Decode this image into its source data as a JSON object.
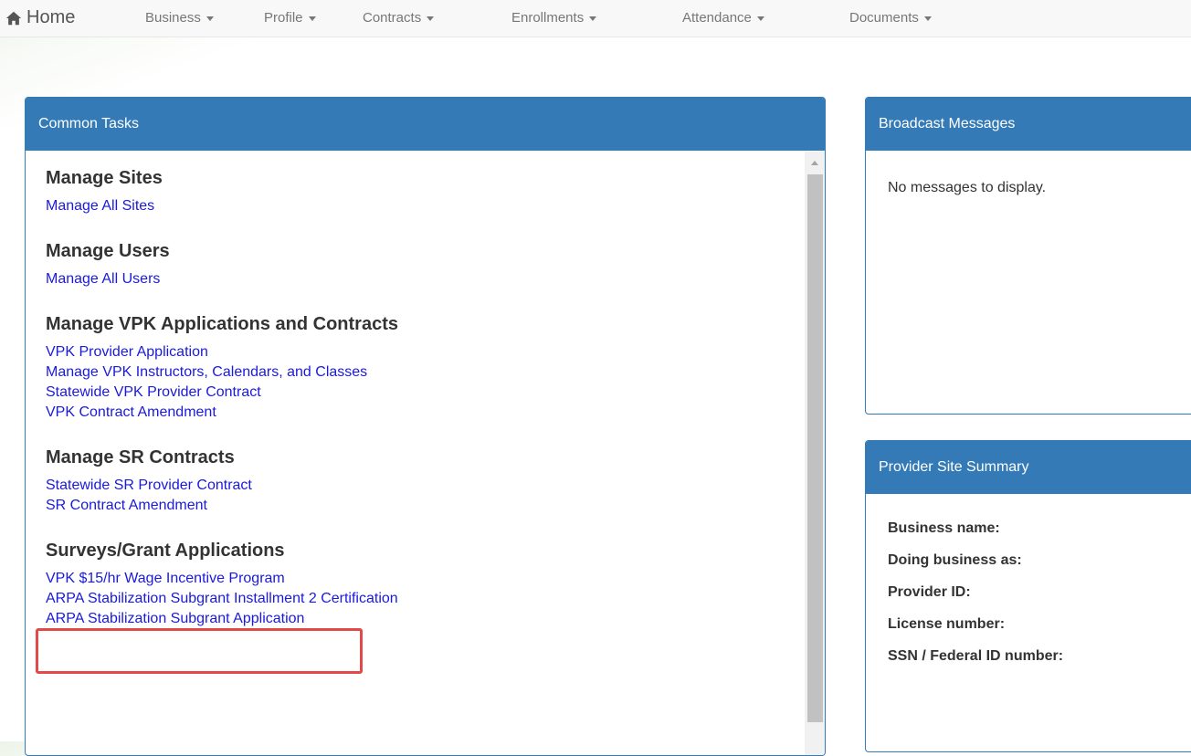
{
  "navbar": {
    "home_label": "Home",
    "items": [
      {
        "label": "Business"
      },
      {
        "label": "Profile"
      },
      {
        "label": "Contracts"
      },
      {
        "label": "Enrollments"
      },
      {
        "label": "Attendance"
      },
      {
        "label": "Documents"
      }
    ]
  },
  "common_tasks": {
    "title": "Common Tasks",
    "sections": [
      {
        "heading": "Manage Sites",
        "links": [
          "Manage All Sites"
        ]
      },
      {
        "heading": "Manage Users",
        "links": [
          "Manage All Users"
        ]
      },
      {
        "heading": "Manage VPK Applications and Contracts",
        "links": [
          "VPK Provider Application",
          "Manage VPK Instructors, Calendars, and Classes",
          "Statewide VPK Provider Contract",
          "VPK Contract Amendment"
        ]
      },
      {
        "heading": "Manage SR Contracts",
        "links": [
          "Statewide SR Provider Contract",
          "SR Contract Amendment"
        ]
      },
      {
        "heading": "Surveys/Grant Applications",
        "links": [
          "VPK $15/hr Wage Incentive Program",
          "ARPA Stabilization Subgrant Installment 2 Certification",
          "ARPA Stabilization Subgrant Application"
        ]
      }
    ]
  },
  "broadcast": {
    "title": "Broadcast Messages",
    "message": "No messages to display."
  },
  "summary": {
    "title": "Provider Site Summary",
    "labels": [
      "Business name:",
      "Doing business as:",
      "Provider ID:",
      "License number:",
      "SSN / Federal ID number:"
    ]
  },
  "colors": {
    "panel_header": "#337ab7",
    "link": "#1a1adb",
    "highlight": "#e34948"
  }
}
